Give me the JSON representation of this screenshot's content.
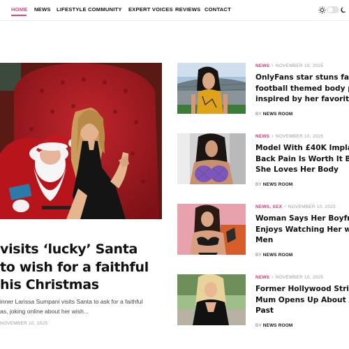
{
  "nav": {
    "items": [
      "HOME",
      "NEWS",
      "LIFESTYLE",
      "COMMUNITY",
      "EXPERT VOICES",
      "REVIEWS",
      "CONTACT"
    ],
    "active": "HOME"
  },
  "featured": {
    "title": "visits ‘lucky’ Santa\nto wish for a faithful\nhis Christmas",
    "excerpt": "inner Larissa Sumpani visits Santa to ask for a faithful\nas, joking online about her wish...",
    "date": "NOVEMBER 10, 2025"
  },
  "articles": [
    {
      "categories": "NEWS",
      "date": "NOVEMBER 10, 2025",
      "title": "OnlyFans star stuns fan\nfootball themed body p\ninspired by her favorite",
      "by": "BY",
      "author": "NEWS ROOM"
    },
    {
      "categories": "NEWS",
      "date": "NOVEMBER 10, 2025",
      "title": "Model With £40K Implan\nBack Pain Is Worth It Be\nShe Loves Her Body",
      "by": "BY",
      "author": "NEWS ROOM"
    },
    {
      "categories": "NEWS, SEX",
      "date": "NOVEMBER 10, 2025",
      "title": "Woman Says Her Boyfrie\nEnjoys Watching Her wit\nMen",
      "by": "BY",
      "author": "NEWS ROOM"
    },
    {
      "categories": "NEWS",
      "date": "NOVEMBER 10, 2025",
      "title": "Former Hollywood Stripp\nMum Opens Up About A\nPast",
      "by": "BY",
      "author": "NEWS ROOM"
    }
  ],
  "colors": {
    "accent": "#e0457b",
    "category": "#d8336a"
  },
  "icons": [
    "sun-icon",
    "theme-toggle",
    "moon-icon"
  ]
}
